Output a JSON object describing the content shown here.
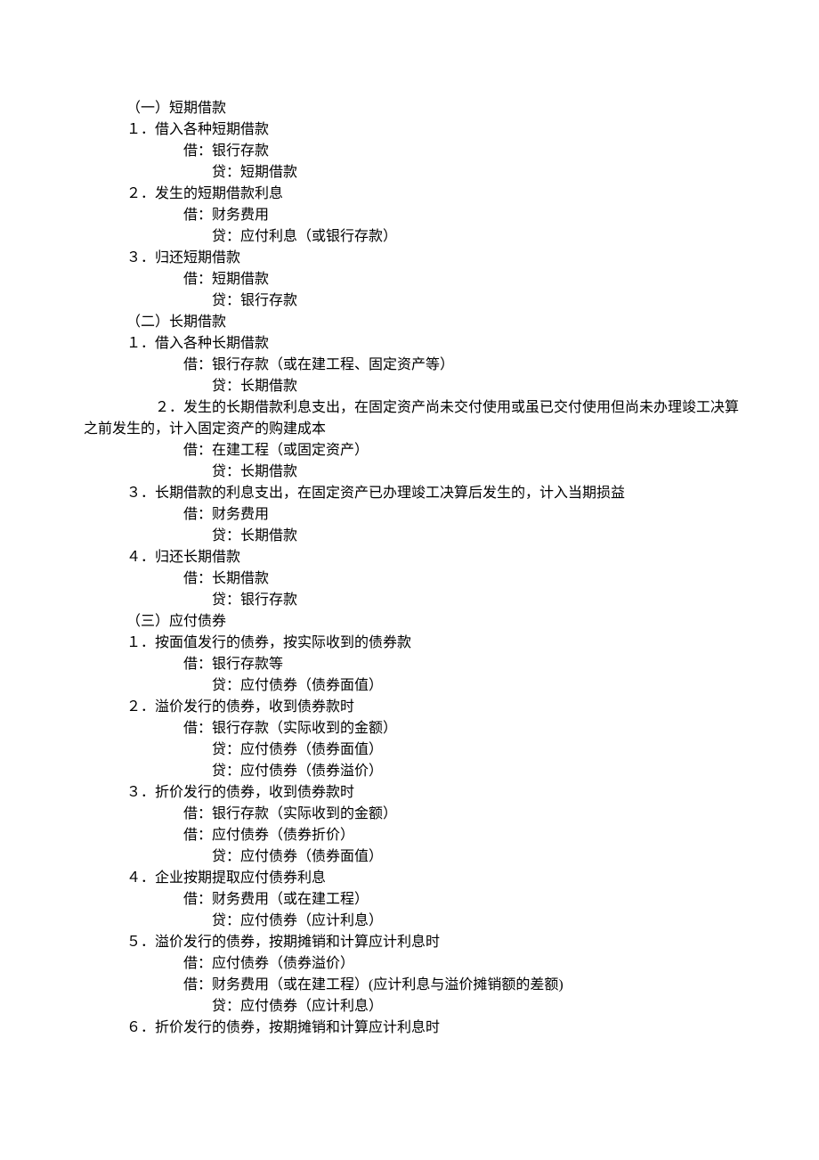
{
  "s1": {
    "heading": "（一）短期借款",
    "i1": {
      "title": "１．借入各种短期借款",
      "dr": "借：银行存款",
      "cr": "贷：短期借款"
    },
    "i2": {
      "title": "２．发生的短期借款利息",
      "dr": "借：财务费用",
      "cr": "贷：应付利息（或银行存款）"
    },
    "i3": {
      "title": "３．归还短期借款",
      "dr": "借：短期借款",
      "cr": "贷：银行存款"
    }
  },
  "s2": {
    "heading": "（二）长期借款",
    "i1": {
      "title": "１．借入各种长期借款",
      "dr": "借：银行存款（或在建工程、固定资产等）",
      "cr": "贷：长期借款"
    },
    "i2": {
      "title_a": "２．发生的长期借款利息支出，在固定资产尚未交付使用或虽已交付使用但尚未办理竣工决算",
      "title_b": "之前发生的，计入固定资产的购建成本",
      "dr": "借：在建工程（或固定资产）",
      "cr": "贷：长期借款"
    },
    "i3": {
      "title": "３．长期借款的利息支出，在固定资产已办理竣工决算后发生的，计入当期损益",
      "dr": "借：财务费用",
      "cr": "贷：长期借款"
    },
    "i4": {
      "title": "４．归还长期借款",
      "dr": "借：长期借款",
      "cr": "贷：银行存款"
    }
  },
  "s3": {
    "heading": "（三）应付债券",
    "i1": {
      "title": "１．按面值发行的债券，按实际收到的债券款",
      "dr": "借：银行存款等",
      "cr": "贷：应付债券（债券面值）"
    },
    "i2": {
      "title": "２．溢价发行的债券，收到债券款时",
      "dr": "借：银行存款（实际收到的金额）",
      "cr1": "贷：应付债券（债券面值）",
      "cr2": "贷：应付债券（债券溢价）"
    },
    "i3": {
      "title": "３．折价发行的债券，收到债券款时",
      "dr1": "借：银行存款（实际收到的金额）",
      "dr2": "借：应付债券（债券折价）",
      "cr": "贷：应付债券（债券面值）"
    },
    "i4": {
      "title": "４．企业按期提取应付债券利息",
      "dr": "借：财务费用（或在建工程）",
      "cr": "贷：应付债券（应计利息）"
    },
    "i5": {
      "title": "５．溢价发行的债券，按期摊销和计算应计利息时",
      "dr1": "借：应付债券（债券溢价）",
      "dr2": "借：财务费用（或在建工程）(应计利息与溢价摊销额的差额)",
      "cr": "贷：应付债券（应计利息）"
    },
    "i6": {
      "title": "６．折价发行的债券，按期摊销和计算应计利息时"
    }
  }
}
